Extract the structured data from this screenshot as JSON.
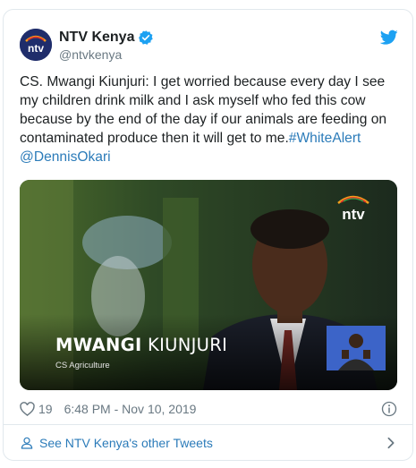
{
  "tweet": {
    "display_name": "NTV Kenya",
    "handle": "@ntvkenya",
    "avatar_logo_text": "ntv",
    "text_main": "CS. Mwangi Kiunjuri: I get worried because every day I see my children drink milk and I ask myself who fed this cow because by the end of the day if our animals are feeding on contaminated produce then it will get to me.",
    "hashtag": "#WhiteAlert",
    "mention": "@DennisOkari",
    "likes": "19",
    "timestamp": "6:48 PM - Nov 10, 2019",
    "more_tweets_label": "See NTV Kenya's other Tweets"
  },
  "media": {
    "lower_third_name_bold": "MWANGI",
    "lower_third_name_regular": " KIUNJURI",
    "lower_third_title": "CS Agriculture",
    "watermark_text": "ntv"
  },
  "icons": {
    "verified": "verified-badge-icon",
    "bird": "twitter-bird-icon",
    "heart": "heart-icon",
    "info": "info-icon",
    "person": "person-icon",
    "chevron": "chevron-right-icon"
  },
  "colors": {
    "link": "#2b7bb9",
    "verified": "#1da1f2",
    "secondary_text": "#697882",
    "border": "#e1e8ed"
  }
}
